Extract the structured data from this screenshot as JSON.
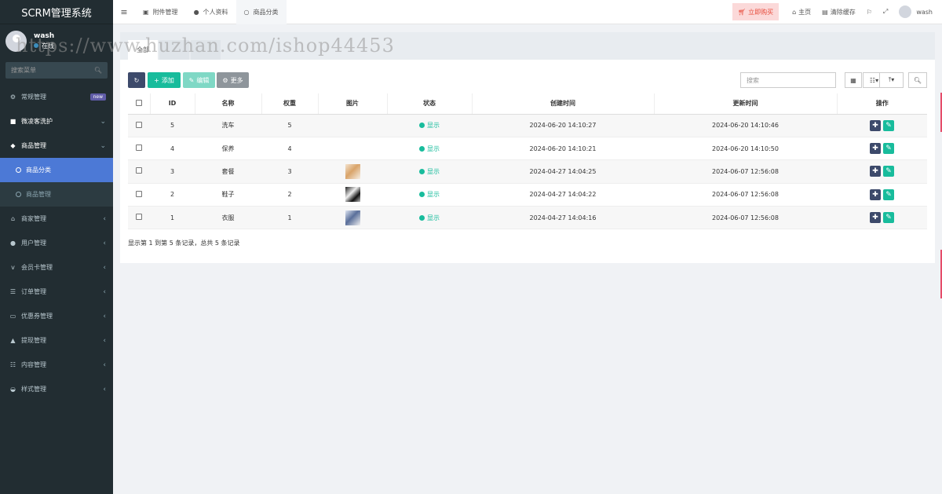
{
  "app": {
    "title": "SCRM管理系统"
  },
  "user": {
    "name": "wash",
    "status": "在线"
  },
  "sidebar": {
    "search_placeholder": "搜索菜单",
    "items": [
      {
        "label": "常规管理",
        "badge": "new"
      },
      {
        "label": "微凌客洗护"
      },
      {
        "label": "商品管理",
        "children": [
          {
            "label": "商品分类"
          },
          {
            "label": "商品管理"
          }
        ]
      },
      {
        "label": "商家管理"
      },
      {
        "label": "用户管理"
      },
      {
        "label": "会员卡管理"
      },
      {
        "label": "订单管理"
      },
      {
        "label": "优惠券管理"
      },
      {
        "label": "提现管理"
      },
      {
        "label": "内容管理"
      },
      {
        "label": "样式管理"
      }
    ]
  },
  "topbar": {
    "tabs": [
      {
        "label": "附件管理"
      },
      {
        "label": "个人资料"
      },
      {
        "label": "商品分类"
      }
    ],
    "buy": "立即购买",
    "home": "主页",
    "clear_cache": "清除缓存",
    "user": "wash"
  },
  "content": {
    "tabs": [
      {
        "label": "全部"
      }
    ],
    "toolbar": {
      "add": "添加",
      "edit": "编辑",
      "more": "更多",
      "search_placeholder": "搜索"
    },
    "table": {
      "headers": [
        "ID",
        "名称",
        "权重",
        "图片",
        "状态",
        "创建时间",
        "更新时间",
        "操作"
      ],
      "rows": [
        {
          "id": "5",
          "name": "洗车",
          "weight": "5",
          "image": "",
          "status": "显示",
          "created": "2024-06-20 14:10:27",
          "updated": "2024-06-20 14:10:46"
        },
        {
          "id": "4",
          "name": "保养",
          "weight": "4",
          "image": "",
          "status": "显示",
          "created": "2024-06-20 14:10:21",
          "updated": "2024-06-20 14:10:50"
        },
        {
          "id": "3",
          "name": "套餐",
          "weight": "3",
          "image": "thumb-warm",
          "status": "显示",
          "created": "2024-04-27 14:04:25",
          "updated": "2024-06-07 12:56:08"
        },
        {
          "id": "2",
          "name": "鞋子",
          "weight": "2",
          "image": "thumb-dark",
          "status": "显示",
          "created": "2024-04-27 14:04:22",
          "updated": "2024-06-07 12:56:08"
        },
        {
          "id": "1",
          "name": "衣服",
          "weight": "1",
          "image": "thumb-cool",
          "status": "显示",
          "created": "2024-04-27 14:04:16",
          "updated": "2024-06-07 12:56:08"
        }
      ]
    },
    "pager_info": "显示第 1 到第 5 条记录，总共 5 条记录"
  },
  "watermark": "https://www.huzhan.com/ishop44453",
  "colors": {
    "sidebar_bg": "#222d32",
    "active_menu": "#4c79d6",
    "primary": "#18bc9c",
    "dark_btn": "#3d4a6b"
  }
}
